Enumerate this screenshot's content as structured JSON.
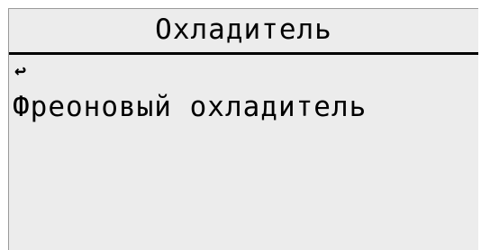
{
  "header": {
    "title": "Охладитель"
  },
  "menu": {
    "back_icon": "return-arrow-icon",
    "back_glyph": "↩",
    "items": [
      {
        "label": "Фреоновый охладитель"
      }
    ]
  },
  "colors": {
    "screen_bg": "#ececec",
    "text": "#000000"
  }
}
